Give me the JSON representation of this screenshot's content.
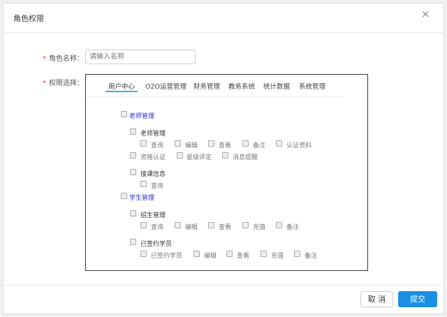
{
  "dialog": {
    "title": "角色权限",
    "close_icon": "×"
  },
  "form": {
    "required_mark": "*",
    "name_label": "角色名称：",
    "name_placeholder": "请输入名称",
    "name_value": "",
    "perm_label": "权限选择："
  },
  "tabs": [
    "用户中心",
    "O2O运营管理",
    "财务管理",
    "教务系统",
    "统计数据",
    "系统管理"
  ],
  "groups": [
    {
      "label": "老师管理",
      "subs": [
        {
          "label": "老师管理",
          "perms": [
            "查询",
            "编辑",
            "查看",
            "备注",
            "认证资料",
            "资格认证",
            "星级评定",
            "消息提醒"
          ]
        },
        {
          "label": "接课信息",
          "perms": [
            "查询"
          ]
        }
      ]
    },
    {
      "label": "学生管理",
      "subs": [
        {
          "label": "招生管理",
          "perms": [
            "查询",
            "编辑",
            "查看",
            "充值",
            "备注"
          ]
        },
        {
          "label": "已签约学员",
          "perms": [
            "已签约学员",
            "编辑",
            "查看",
            "充值",
            "备注"
          ]
        }
      ]
    }
  ],
  "footer": {
    "cancel": "取 消",
    "submit": "提交"
  }
}
